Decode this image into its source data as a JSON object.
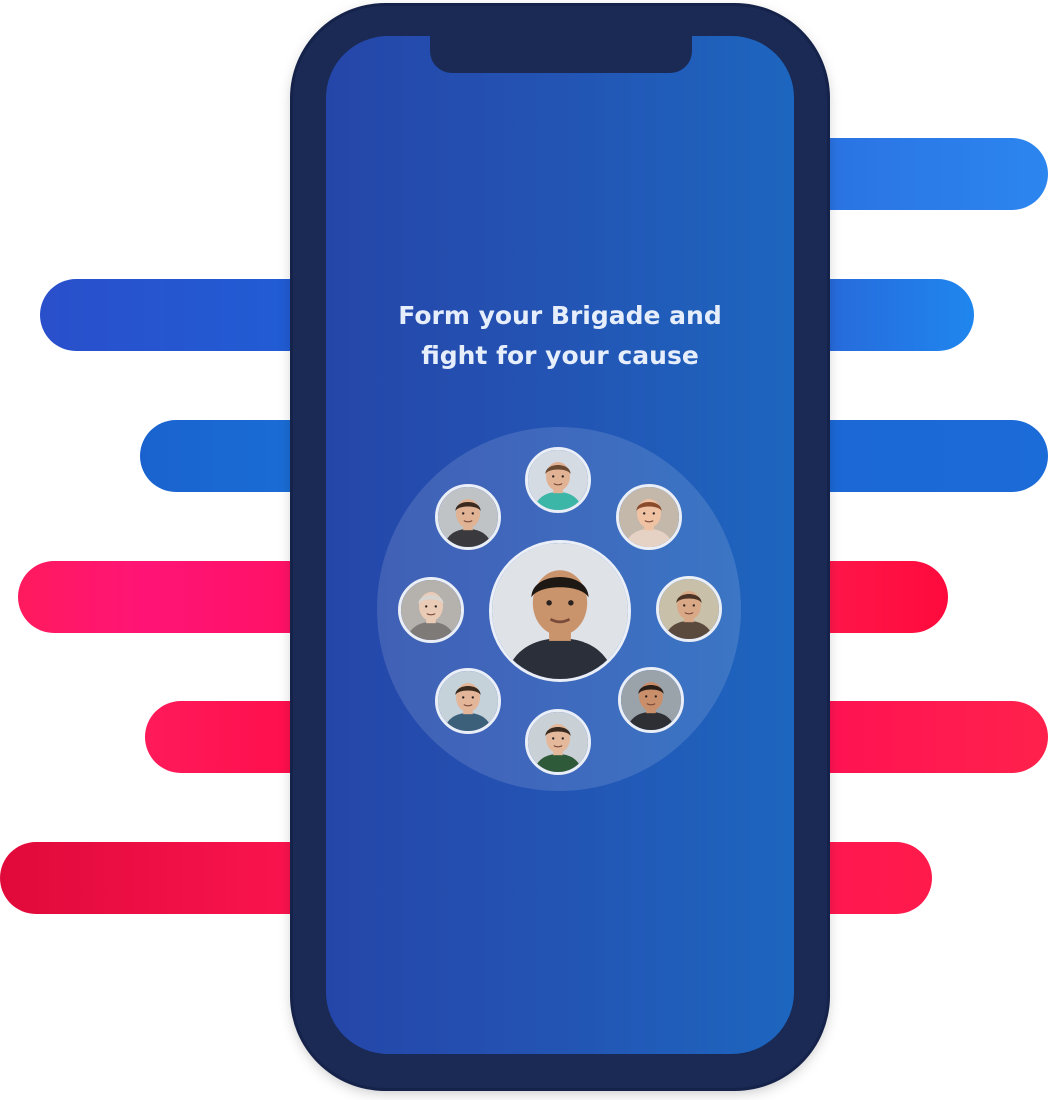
{
  "screen": {
    "headline_line1": "Form your Brigade and",
    "headline_line2": "fight for your cause"
  },
  "colors": {
    "phone_frame": "#1a2a55",
    "screen_left": "#2546a9",
    "screen_right": "#1d66bf",
    "accent_blue": "#2a86ef",
    "accent_red": "#ff1552"
  },
  "avatars": [
    {
      "name": "center-member",
      "skin": "#c9936c",
      "hair": "#1e1814",
      "shirt": "#2b2f3a",
      "bg": "#dfe3e8"
    },
    {
      "name": "top-member",
      "skin": "#e2b294",
      "hair": "#6b4a32",
      "shirt": "#3bb6a7",
      "bg": "#d5dbe2"
    },
    {
      "name": "top-right-member",
      "skin": "#f0c2a4",
      "hair": "#8a4a2c",
      "shirt": "#e6d2c4",
      "bg": "#c4b8aa"
    },
    {
      "name": "right-member",
      "skin": "#d9a987",
      "hair": "#4a3224",
      "shirt": "#5a4a3e",
      "bg": "#c8c0a8"
    },
    {
      "name": "bottom-right-member",
      "skin": "#c98f6a",
      "hair": "#2a1e18",
      "shirt": "#2d2f35",
      "bg": "#9aa2aa"
    },
    {
      "name": "bottom-member",
      "skin": "#e4b89a",
      "hair": "#3a2b20",
      "shirt": "#2f5a3a",
      "bg": "#c9d0d6"
    },
    {
      "name": "bottom-left-member",
      "skin": "#e3b69a",
      "hair": "#3b2a1e",
      "shirt": "#3c5f7a",
      "bg": "#c6d2da"
    },
    {
      "name": "left-member",
      "skin": "#eacbb6",
      "hair": "#d9d5d0",
      "shirt": "#7d7a78",
      "bg": "#b5b1ad"
    },
    {
      "name": "top-left-member",
      "skin": "#e0b395",
      "hair": "#3a2a20",
      "shirt": "#3a3a3e",
      "bg": "#bfc3c6"
    }
  ]
}
